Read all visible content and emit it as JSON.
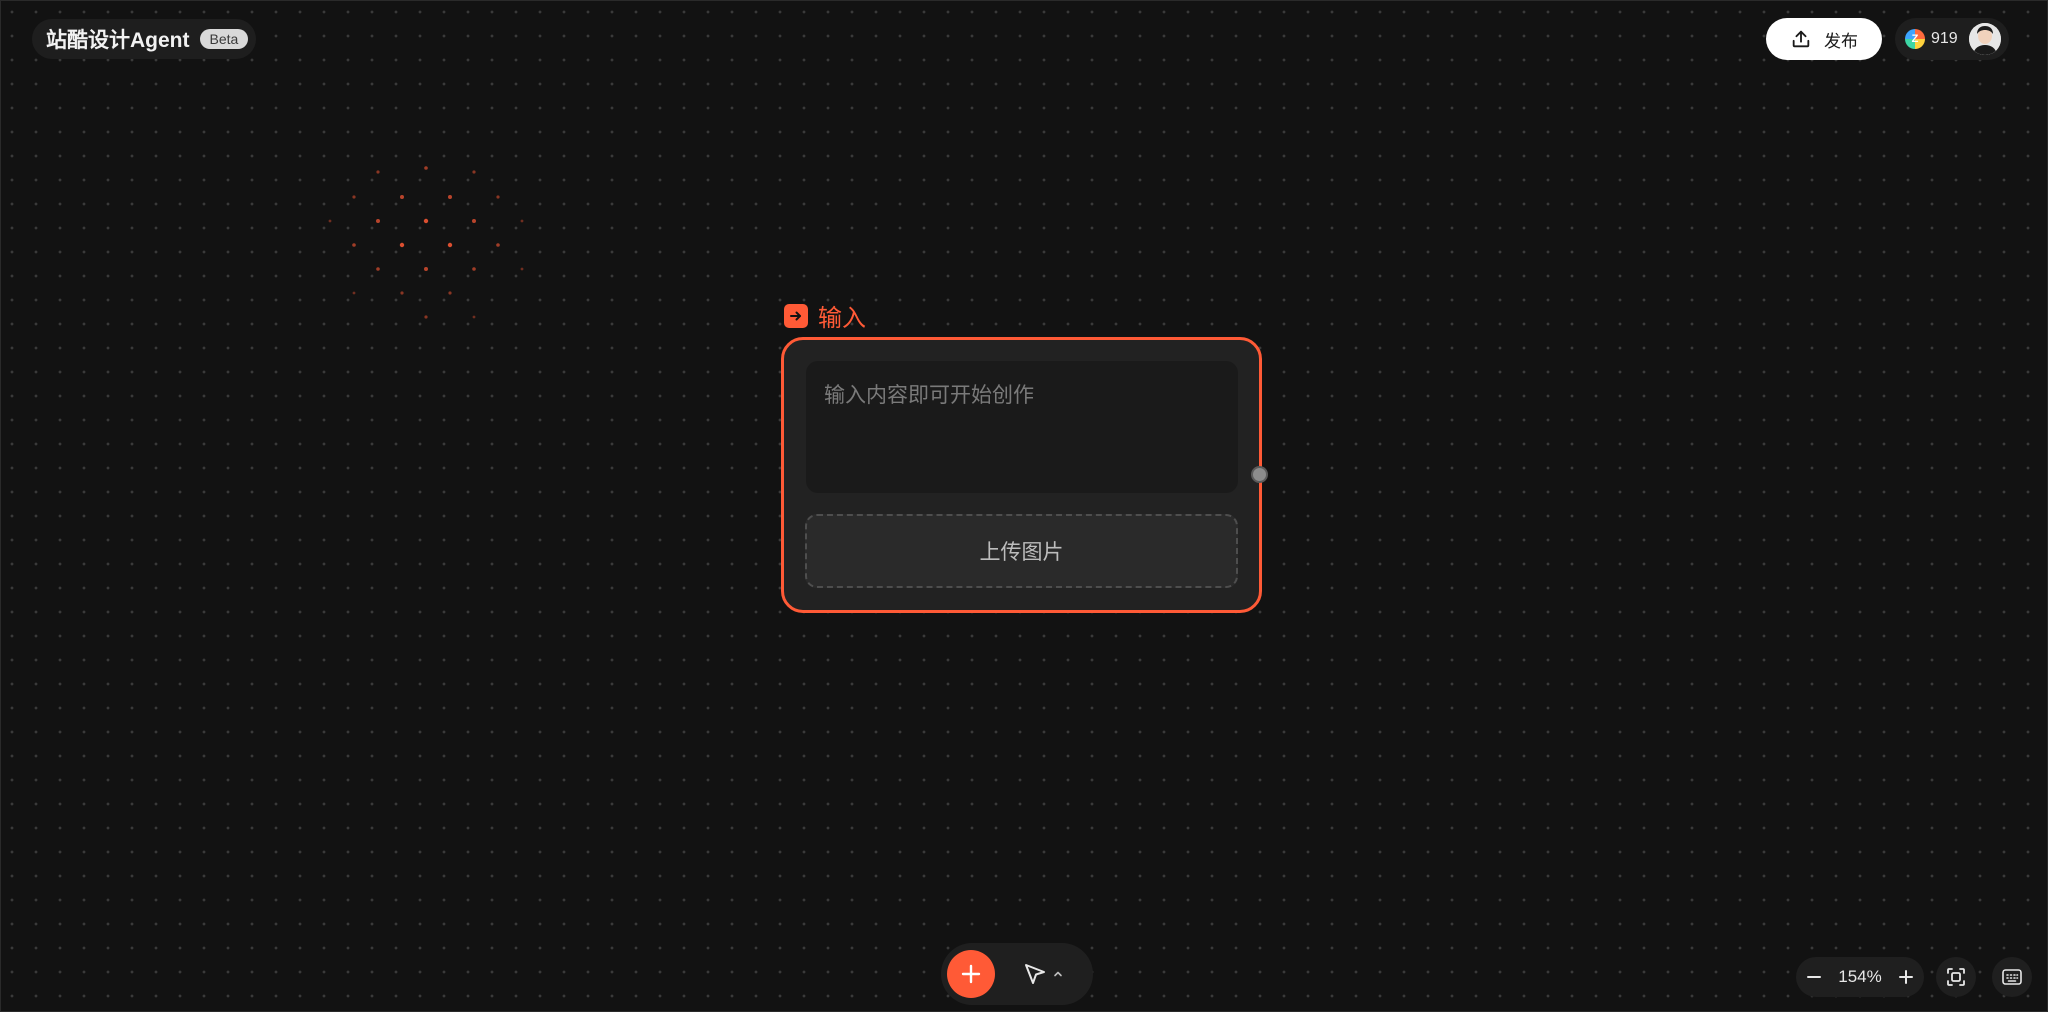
{
  "brand": {
    "name": "站酷设计Agent",
    "badge": "Beta"
  },
  "header": {
    "publish_label": "发布",
    "coins": "919",
    "coin_icon_letter": "Z"
  },
  "node": {
    "title": "输入",
    "input_placeholder": "输入内容即可开始创作",
    "upload_label": "上传图片"
  },
  "toolbar": {
    "add_icon": "plus-icon",
    "select_icon": "cursor-arrow-icon"
  },
  "zoom": {
    "value": "154%"
  },
  "colors": {
    "accent": "#ff5a36",
    "background": "#121212",
    "panel": "#1f1f1f"
  }
}
